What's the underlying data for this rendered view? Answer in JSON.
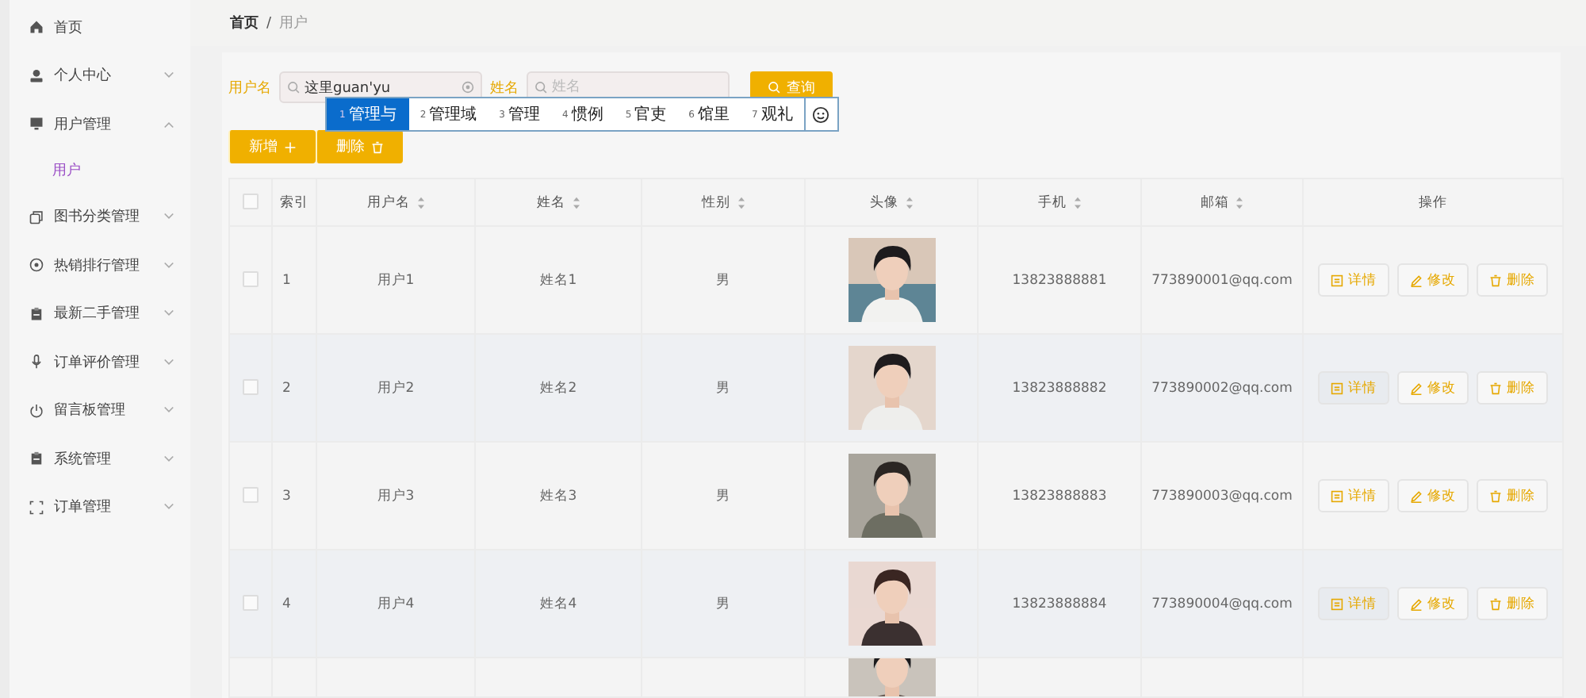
{
  "sidebar": {
    "items": [
      {
        "label": "首页"
      },
      {
        "label": "个人中心",
        "expanded": false
      },
      {
        "label": "用户管理",
        "expanded": true,
        "children": [
          {
            "label": "用户",
            "selected": true
          }
        ]
      },
      {
        "label": "图书分类管理",
        "expanded": false
      },
      {
        "label": "热销排行管理",
        "expanded": false
      },
      {
        "label": "最新二手管理",
        "expanded": false
      },
      {
        "label": "订单评价管理",
        "expanded": false
      },
      {
        "label": "留言板管理",
        "expanded": false
      },
      {
        "label": "系统管理",
        "expanded": false
      },
      {
        "label": "订单管理",
        "expanded": false
      }
    ]
  },
  "breadcrumb": {
    "items": [
      {
        "label": "首页",
        "current": false
      },
      {
        "label": "用户",
        "current": true
      }
    ],
    "separator": "/"
  },
  "search": {
    "fields": [
      {
        "label": "用户名",
        "value": "这里guan'yu"
      },
      {
        "label": "姓名",
        "placeholder": "姓名"
      }
    ],
    "button": "查询"
  },
  "ime": {
    "candidates": [
      {
        "number": "1",
        "text": "管理与",
        "selected": true
      },
      {
        "number": "2",
        "text": "管理域",
        "selected": false
      },
      {
        "number": "3",
        "text": "管理",
        "selected": false
      },
      {
        "number": "4",
        "text": "惯例",
        "selected": false
      },
      {
        "number": "5",
        "text": "官吏",
        "selected": false
      },
      {
        "number": "6",
        "text": "馆里",
        "selected": false
      },
      {
        "number": "7",
        "text": "观礼",
        "selected": false
      }
    ]
  },
  "actions": [
    "新增",
    "删除"
  ],
  "table": {
    "header_checked": false,
    "columns": [
      {
        "label": "索引",
        "sortable": false
      },
      {
        "label": "用户名",
        "sortable": true
      },
      {
        "label": "姓名",
        "sortable": true
      },
      {
        "label": "性别",
        "sortable": true
      },
      {
        "label": "头像",
        "sortable": true
      },
      {
        "label": "手机",
        "sortable": true
      },
      {
        "label": "邮箱",
        "sortable": true
      },
      {
        "label": "操作",
        "sortable": false
      }
    ],
    "rows": [
      {
        "checked": false,
        "index": "1",
        "username": "用户1",
        "name": "姓名1",
        "gender": "男",
        "avatar": {
          "kind": "picture"
        },
        "phone": "13823888881",
        "email": "773890001@qq.com",
        "highlighted": false,
        "buttons": [
          "详情",
          "修改",
          "删除"
        ]
      },
      {
        "checked": false,
        "index": "2",
        "username": "用户2",
        "name": "姓名2",
        "gender": "男",
        "avatar": {
          "kind": "picture"
        },
        "phone": "13823888882",
        "email": "773890002@qq.com",
        "highlighted": true,
        "buttons": [
          "详情",
          "修改",
          "删除"
        ]
      },
      {
        "checked": false,
        "index": "3",
        "username": "用户3",
        "name": "姓名3",
        "gender": "男",
        "avatar": {
          "kind": "picture"
        },
        "phone": "13823888883",
        "email": "773890003@qq.com",
        "highlighted": false,
        "buttons": [
          "详情",
          "修改",
          "删除"
        ]
      },
      {
        "checked": false,
        "index": "4",
        "username": "用户4",
        "name": "姓名4",
        "gender": "男",
        "avatar": {
          "kind": "picture"
        },
        "phone": "13823888884",
        "email": "773890004@qq.com",
        "highlighted": true,
        "buttons": [
          "详情",
          "修改",
          "删除"
        ]
      }
    ],
    "partial_row": {
      "avatar": {
        "kind": "picture"
      }
    }
  }
}
